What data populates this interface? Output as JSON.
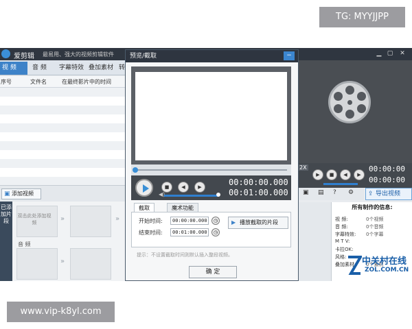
{
  "app": {
    "title": "爱剪辑",
    "slogan": "最易用、强大的视频剪辑软件"
  },
  "tabs": [
    {
      "label": "视 频"
    },
    {
      "label": "音 频"
    },
    {
      "label": "字幕特效"
    },
    {
      "label": "叠加素材"
    },
    {
      "label": "转"
    }
  ],
  "table": {
    "headers": [
      "序号",
      "文件名",
      "在最终影片中的时间"
    ]
  },
  "add_video_label": "添加视频",
  "timeline": {
    "side_label": "已添加片段",
    "clip_hint": "双击此处添加视频",
    "audio_label": "音 频"
  },
  "dialog": {
    "title": "预览/截取",
    "close_symbol": "−",
    "time_current": "00:00:00.000",
    "time_total": "00:01:00.000",
    "subtabs": [
      "截取",
      "魔术功能"
    ],
    "start_label": "开始时间:",
    "start_value": "00:00:00.000",
    "end_label": "结束时间:",
    "end_value": "00:01:00.000",
    "play_segment_label": "播放截取的片段",
    "hint": "提示：不设置截取时间则默认插入整段视频。",
    "ok_label": "确 定"
  },
  "right_panel": {
    "time_current": "00:00:00",
    "time_total": "00:00:00",
    "export_label": "导出视频",
    "zoom_label": "2X",
    "info_title": "所有制作的信息:",
    "info": [
      {
        "key": "视 频:",
        "value": "0个视频"
      },
      {
        "key": "音 频:",
        "value": "0个音频"
      },
      {
        "key": "字幕特效:",
        "value": "0个字幕"
      },
      {
        "key": "M T V:",
        "value": ""
      },
      {
        "key": "卡拉OK:",
        "value": ""
      },
      {
        "key": "风格:",
        "value": ""
      },
      {
        "key": "叠加素材:",
        "value": "0个素材"
      }
    ]
  },
  "watermarks": {
    "top": "TG: MYYJJPP",
    "bottom": "www.vip-k8yl.com",
    "zol_cn": "中关村在线",
    "zol_en": "ZOL.COM.CN"
  },
  "colors": {
    "accent": "#3d82c8",
    "dark_bar": "#2f3640",
    "player_bg": "#43484e"
  }
}
